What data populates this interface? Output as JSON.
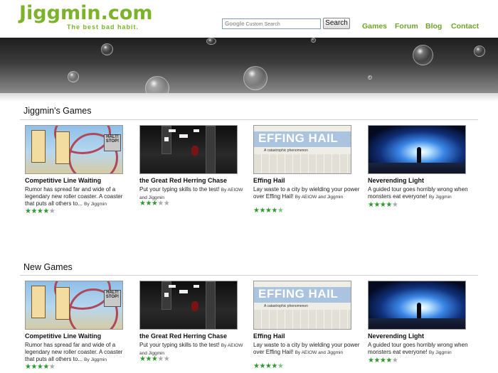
{
  "header": {
    "logo_title": "Jiggmin.com",
    "logo_tagline": "The best bad habit.",
    "search": {
      "google_word": "Google",
      "placeholder": "Custom Search",
      "button_label": "Search"
    },
    "nav": [
      "Games",
      "Forum",
      "Blog",
      "Contact"
    ]
  },
  "colors": {
    "brand_green": "#7cb32a",
    "star_green": "#2d9a2d"
  },
  "sections": [
    {
      "title": "Jiggmin's Games",
      "games": [
        {
          "title": "Competitive Line Waiting",
          "desc": "Rumor has spread far and wide of a legendary new roller coaster. A coaster that puts all others to...",
          "by": "By Jiggmin",
          "rating": 4,
          "sign_text": "HALT! STOP!"
        },
        {
          "title": "the Great Red Herring Chase",
          "desc": "Put your typing skills to the test!",
          "by": "By AEIOW and Jiggmin",
          "rating": 3
        },
        {
          "title": "Effing Hail",
          "desc": "Lay waste to a city by wielding your power over Effing Hail!",
          "by": "By AEIOW and Jiggmin",
          "rating": 4.5,
          "thumb_title": "EFFING HAIL",
          "thumb_sub": "A catastrophic phenomenon"
        },
        {
          "title": "Neverending Light",
          "desc": "A guided tour goes horribly wrong when monsters eat everyone!",
          "by": "By Jiggmin",
          "rating": 4
        }
      ]
    },
    {
      "title": "New Games",
      "games": [
        {
          "title": "Competitive Line Waiting",
          "desc": "Rumor has spread far and wide of a legendary new roller coaster. A coaster that puts all others to...",
          "by": "By Jiggmin",
          "rating": 4,
          "sign_text": "HALT! STOP!"
        },
        {
          "title": "the Great Red Herring Chase",
          "desc": "Put your typing skills to the test!",
          "by": "By AEIOW and Jiggmin",
          "rating": 3
        },
        {
          "title": "Effing Hail",
          "desc": "Lay waste to a city by wielding your power over Effing Hail!",
          "by": "By AEIOW and Jiggmin",
          "rating": 4.5,
          "thumb_title": "EFFING HAIL",
          "thumb_sub": "A catastrophic phenomenon"
        },
        {
          "title": "Neverending Light",
          "desc": "A guided tour goes horribly wrong when monsters eat everyone!",
          "by": "By Jiggmin",
          "rating": 4
        }
      ]
    }
  ]
}
